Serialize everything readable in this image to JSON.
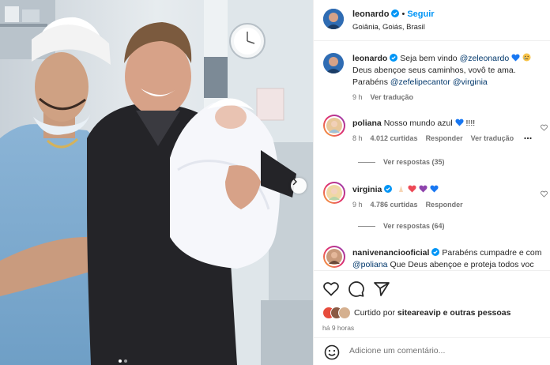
{
  "colors": {
    "accent": "#0095f6",
    "verified": "#0095f6",
    "mention": "#00376b",
    "heart_blue": "#1877f2",
    "muted": "#737373"
  },
  "header": {
    "username": "leonardo",
    "separator": "•",
    "follow_label": "Seguir",
    "location": "Goiânia, Goiás, Brasil",
    "avatar_icon": "leonardo-avatar"
  },
  "caption": {
    "username": "leonardo",
    "line1_text": "Seja bem vindo",
    "line1_mention": "@zeleonardo",
    "line1_emojis": "blue-heart, crying-face",
    "line2": "Deus abençoe seus caminhos, vovô te ama.",
    "line3_text": "Parabéns",
    "mention2": "@zefelipecantor",
    "mention3": "@virginia",
    "time": "9 h",
    "translate": "Ver tradução"
  },
  "comments": [
    {
      "username": "poliana",
      "text": "Nosso mundo azul",
      "suffix": "!!!!",
      "emojis": "blue-heart",
      "time": "8 h",
      "likes": "4.012 curtidas",
      "reply": "Responder",
      "translate": "Ver tradução",
      "more_icon": "more-options-icon",
      "view_replies": "Ver respostas (35)"
    },
    {
      "username": "virginia",
      "text": "",
      "emojis": "praying-hands, red-heart, purple-heart, blue-heart",
      "time": "9 h",
      "likes": "4.786 curtidas",
      "reply": "Responder",
      "view_replies": "Ver respostas (64)"
    },
    {
      "username": "nanivenanciooficial",
      "text": "Parabéns cumpadre e com",
      "mention": "@poliana",
      "text2": "Que Deus abençoe e proteja todos voc"
    }
  ],
  "actions": {
    "like_icon": "heart-outline-icon",
    "comment_icon": "comment-icon",
    "share_icon": "send-icon",
    "liked_by_prefix": "Curtido por",
    "liked_by_user": "siteareavip",
    "liked_by_suffix": "e outras pessoas",
    "time_ago": "há 9 horas"
  },
  "add_comment": {
    "emoji_icon": "smiley-icon",
    "placeholder": "Adicione um comentário..."
  },
  "carousel": {
    "next_icon": "chevron-right-icon",
    "slides_total": 2,
    "current_slide": 1
  }
}
